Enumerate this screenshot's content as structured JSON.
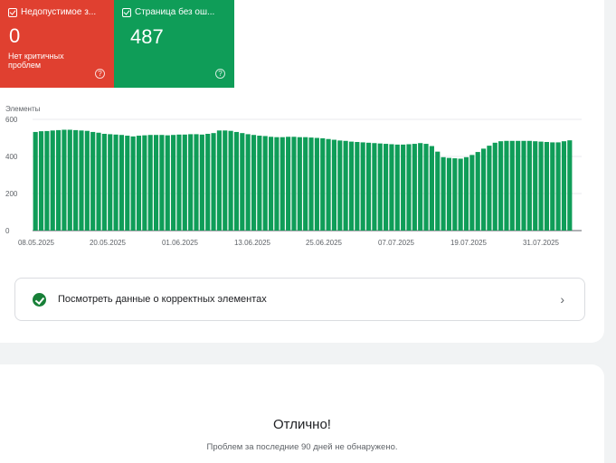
{
  "tiles": {
    "error": {
      "label": "Недопустимое з...",
      "value": "0",
      "subtitle": "Нет критичных проблем",
      "color": "#e04030"
    },
    "valid": {
      "label": "Страница без ош...",
      "value": "487",
      "color": "#0f9d58"
    }
  },
  "chart_data": {
    "type": "bar",
    "ylabel": "Элементы",
    "ylim": [
      0,
      600
    ],
    "yticks": [
      0,
      200,
      400,
      600
    ],
    "xtick_labels": [
      "08.05.2025",
      "20.05.2025",
      "01.06.2025",
      "13.06.2025",
      "25.06.2025",
      "07.07.2025",
      "19.07.2025",
      "31.07.2025"
    ],
    "start_date": "08.05.2025",
    "bar_color": "#0f9d58",
    "values": [
      532,
      536,
      537,
      540,
      542,
      544,
      544,
      542,
      540,
      538,
      532,
      528,
      522,
      520,
      518,
      516,
      512,
      508,
      512,
      514,
      516,
      516,
      516,
      514,
      516,
      518,
      518,
      520,
      520,
      518,
      522,
      526,
      540,
      540,
      538,
      532,
      526,
      520,
      516,
      512,
      510,
      506,
      504,
      504,
      506,
      506,
      504,
      504,
      502,
      500,
      498,
      494,
      490,
      486,
      484,
      480,
      478,
      476,
      474,
      472,
      470,
      468,
      466,
      464,
      464,
      466,
      468,
      472,
      468,
      456,
      426,
      396,
      392,
      390,
      388,
      396,
      408,
      424,
      442,
      458,
      474,
      482,
      484,
      484,
      484,
      484,
      484,
      482,
      480,
      478,
      476,
      476,
      482,
      487
    ]
  },
  "valid_link": {
    "label": "Посмотреть данные о корректных элементах",
    "icon": "check-circle-icon",
    "chevron": "chevron-right-icon"
  },
  "status": {
    "title": "Отлично!",
    "subtitle": "Проблем за последние 90 дней не обнаружено."
  }
}
